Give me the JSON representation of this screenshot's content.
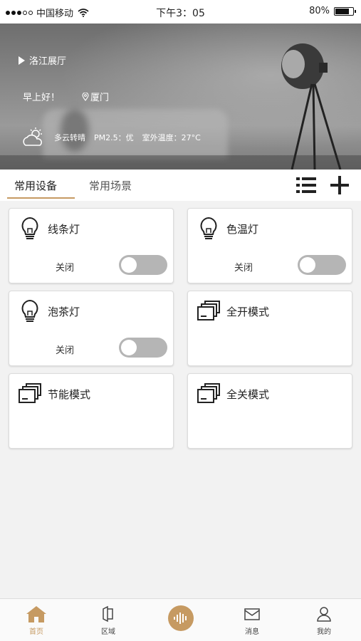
{
  "status_bar": {
    "carrier": "中国移动",
    "time": "下午3：05",
    "battery": "80%",
    "battery_level": 0.8
  },
  "hero": {
    "location": "洛江展厅",
    "greeting": "早上好！",
    "city": "厦门",
    "weather": "多云转晴",
    "pm25": "PM2.5：优",
    "outdoor_temp": "室外温度：27°C"
  },
  "tabs": [
    {
      "label": "常用设备",
      "active": true
    },
    {
      "label": "常用场景",
      "active": false
    }
  ],
  "cards": [
    {
      "title": "线条灯",
      "type": "light",
      "state": "关闭",
      "on": false
    },
    {
      "title": "色温灯",
      "type": "light",
      "state": "关闭",
      "on": false
    },
    {
      "title": "泡茶灯",
      "type": "light",
      "state": "关闭",
      "on": false
    },
    {
      "title": "全开模式",
      "type": "scene"
    },
    {
      "title": "节能模式",
      "type": "scene"
    },
    {
      "title": "全关模式",
      "type": "scene"
    }
  ],
  "bottom_nav": [
    {
      "label": "首页",
      "icon": "home-icon",
      "active": true
    },
    {
      "label": "区域",
      "icon": "door-icon",
      "active": false
    },
    {
      "label": "消息",
      "icon": "envelope-icon",
      "active": false
    },
    {
      "label": "我的",
      "icon": "user-icon",
      "active": false
    }
  ],
  "colors": {
    "accent": "#c69a62",
    "toggle_off": "#b5b5b5"
  }
}
